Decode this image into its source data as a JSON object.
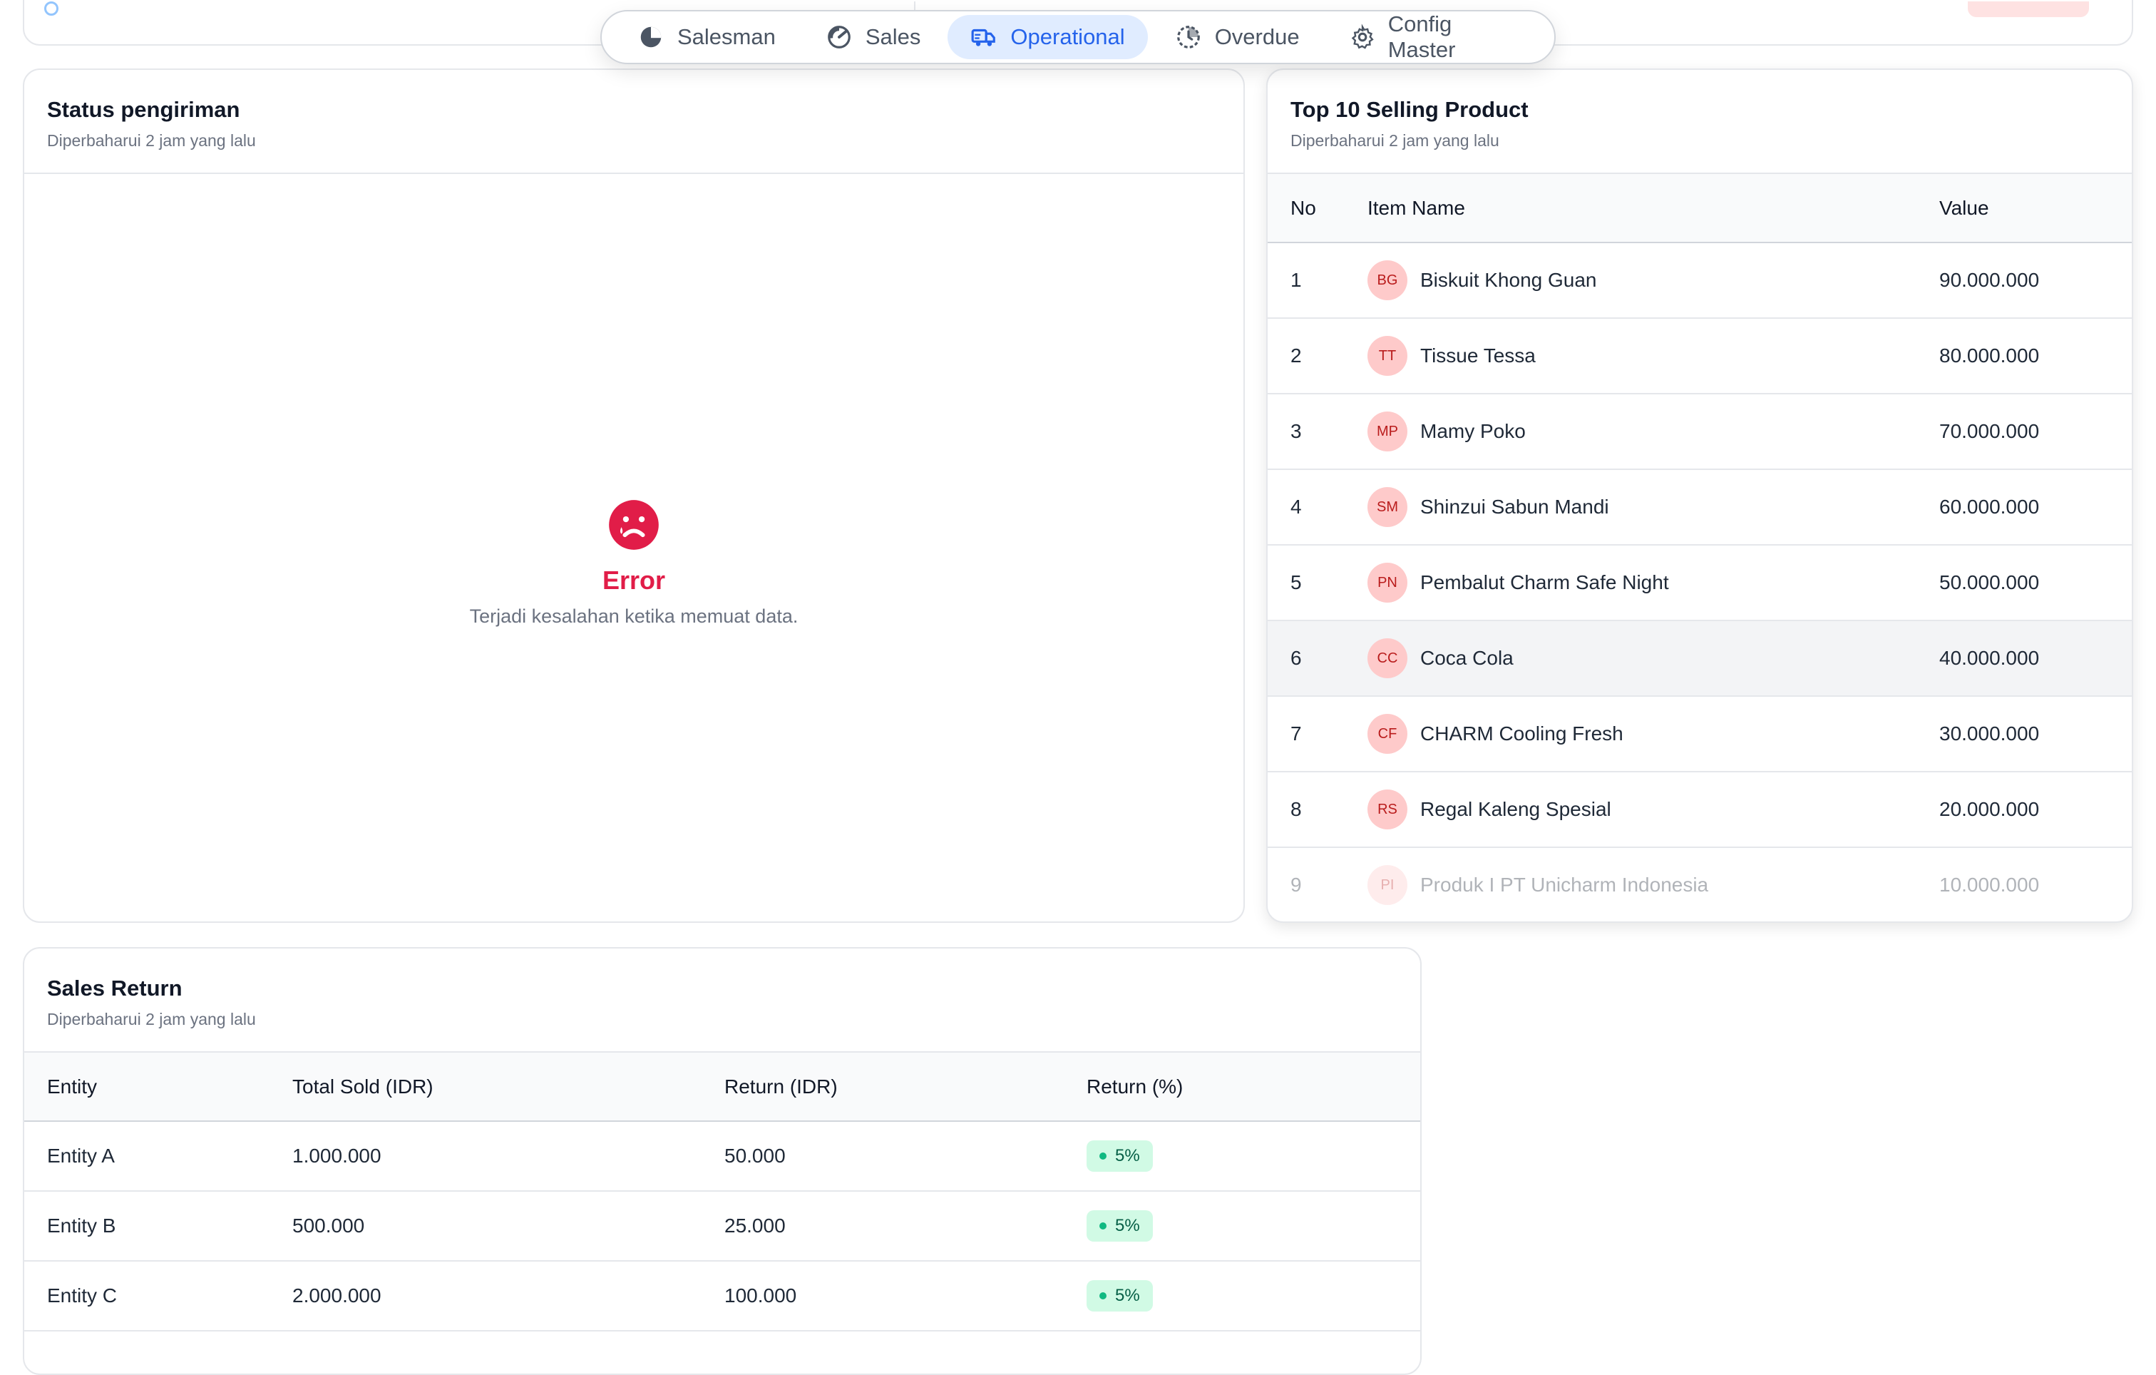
{
  "nav": {
    "items": [
      {
        "label": "Salesman",
        "icon": "pie-icon"
      },
      {
        "label": "Sales",
        "icon": "gauge-icon"
      },
      {
        "label": "Operational",
        "icon": "truck-icon"
      },
      {
        "label": "Overdue",
        "icon": "clock-icon"
      },
      {
        "label": "Config Master",
        "icon": "gear-icon"
      }
    ],
    "active": "Operational"
  },
  "status_card": {
    "title": "Status pengiriman",
    "updated": "Diperbaharui 2 jam yang lalu",
    "error_title": "Error",
    "error_text": "Terjadi kesalahan ketika memuat data."
  },
  "top_card": {
    "title": "Top 10 Selling Product",
    "updated": "Diperbaharui 2 jam yang lalu",
    "columns": [
      "No",
      "Item Name",
      "Value"
    ],
    "rows": [
      {
        "no": "1",
        "initials": "BG",
        "name": "Biskuit Khong Guan",
        "value": "90.000.000"
      },
      {
        "no": "2",
        "initials": "TT",
        "name": "Tissue Tessa",
        "value": "80.000.000"
      },
      {
        "no": "3",
        "initials": "MP",
        "name": "Mamy Poko",
        "value": "70.000.000"
      },
      {
        "no": "4",
        "initials": "SM",
        "name": "Shinzui Sabun Mandi",
        "value": "60.000.000"
      },
      {
        "no": "5",
        "initials": "PN",
        "name": "Pembalut Charm Safe Night",
        "value": "50.000.000"
      },
      {
        "no": "6",
        "initials": "CC",
        "name": "Coca Cola",
        "value": "40.000.000"
      },
      {
        "no": "7",
        "initials": "CF",
        "name": "CHARM Cooling Fresh",
        "value": "30.000.000"
      },
      {
        "no": "8",
        "initials": "RS",
        "name": "Regal Kaleng Spesial",
        "value": "20.000.000"
      },
      {
        "no": "9",
        "initials": "PI",
        "name": "Produk I PT Unicharm Indonesia",
        "value": "10.000.000"
      }
    ]
  },
  "return_card": {
    "title": "Sales Return",
    "updated": "Diperbaharui 2 jam yang lalu",
    "columns": [
      "Entity",
      "Total Sold (IDR)",
      "Return (IDR)",
      "Return (%)"
    ],
    "rows": [
      {
        "entity": "Entity A",
        "sold": "1.000.000",
        "ret": "50.000",
        "pct": "5%"
      },
      {
        "entity": "Entity B",
        "sold": "500.000",
        "ret": "25.000",
        "pct": "5%"
      },
      {
        "entity": "Entity C",
        "sold": "2.000.000",
        "ret": "100.000",
        "pct": "5%"
      }
    ]
  },
  "colors": {
    "accent": "#2563eb",
    "error": "#e11d48",
    "success": "#10b981"
  }
}
